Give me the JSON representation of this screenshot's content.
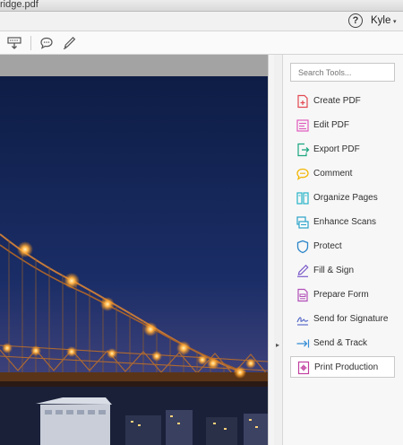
{
  "window": {
    "title": "ridge.pdf"
  },
  "account": {
    "help_symbol": "?",
    "user_name": "Kyle",
    "caret": "▾"
  },
  "toolbar": {
    "icons": [
      "scan-to-pdf-icon",
      "comment-icon",
      "pen-icon"
    ]
  },
  "panel": {
    "search_placeholder": "Search Tools...",
    "collapse_glyph": "▸",
    "tools": [
      {
        "label": "Create PDF",
        "icon": "create-pdf-icon",
        "color": "#e34850"
      },
      {
        "label": "Edit PDF",
        "icon": "edit-pdf-icon",
        "color": "#e05bbd"
      },
      {
        "label": "Export PDF",
        "icon": "export-pdf-icon",
        "color": "#1aa67f"
      },
      {
        "label": "Comment",
        "icon": "comment-icon",
        "color": "#f2b705"
      },
      {
        "label": "Organize Pages",
        "icon": "organize-pages-icon",
        "color": "#26b3c7"
      },
      {
        "label": "Enhance Scans",
        "icon": "enhance-scans-icon",
        "color": "#2aa3c9"
      },
      {
        "label": "Protect",
        "icon": "protect-shield-icon",
        "color": "#2e86c9"
      },
      {
        "label": "Fill & Sign",
        "icon": "fill-sign-icon",
        "color": "#7b5bc9"
      },
      {
        "label": "Prepare Form",
        "icon": "prepare-form-icon",
        "color": "#b24fb8"
      },
      {
        "label": "Send for Signature",
        "icon": "send-for-signature-icon",
        "color": "#5b6ec9"
      },
      {
        "label": "Send & Track",
        "icon": "send-track-icon",
        "color": "#3a8fd6"
      },
      {
        "label": "Print Production",
        "icon": "print-production-icon",
        "color": "#c13fa0"
      }
    ]
  }
}
